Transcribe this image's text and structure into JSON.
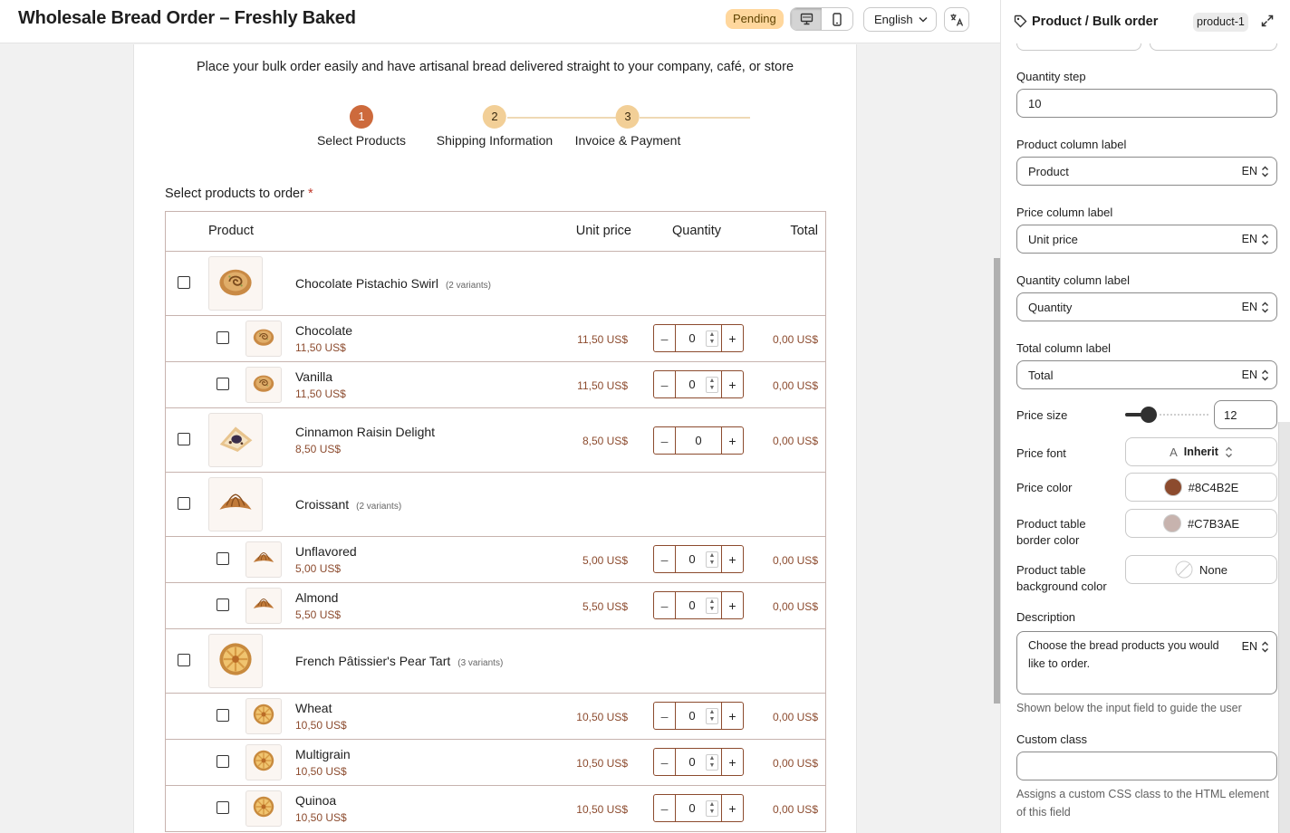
{
  "header": {
    "title": "Wholesale Bread Order – Freshly Baked",
    "status": "Pending",
    "language": "English"
  },
  "form": {
    "subtitle": "Place your bulk order easily and have artisanal bread delivered straight to your company, café, or store",
    "steps": [
      {
        "number": "1",
        "label": "Select Products",
        "state": "active"
      },
      {
        "number": "2",
        "label": "Shipping Information",
        "state": "todo"
      },
      {
        "number": "3",
        "label": "Invoice & Payment",
        "state": "todo"
      }
    ],
    "field_label": "Select products to order",
    "required_mark": "*",
    "table": {
      "columns": {
        "product": "Product",
        "unit_price": "Unit price",
        "quantity": "Quantity",
        "total": "Total"
      },
      "rows": [
        {
          "type": "parent",
          "name": "Chocolate Pistachio Swirl",
          "variants": "(2 variants)",
          "image": "pastry-swirl-icon"
        },
        {
          "type": "child",
          "name": "Chocolate",
          "price": "11,50 US$",
          "unit_price": "11,50 US$",
          "qty": "0",
          "total": "0,00 US$",
          "image": "pastry-swirl-icon"
        },
        {
          "type": "child",
          "name": "Vanilla",
          "price": "11,50 US$",
          "unit_price": "11,50 US$",
          "qty": "0",
          "total": "0,00 US$",
          "image": "pastry-swirl-icon"
        },
        {
          "type": "solo",
          "name": "Cinnamon Raisin Delight",
          "price": "8,50 US$",
          "unit_price": "8,50 US$",
          "qty": "0",
          "total": "0,00 US$",
          "image": "pastry-danish-icon"
        },
        {
          "type": "parent",
          "name": "Croissant",
          "variants": "(2 variants)",
          "image": "croissant-icon"
        },
        {
          "type": "child",
          "name": "Unflavored",
          "price": "5,00 US$",
          "unit_price": "5,00 US$",
          "qty": "0",
          "total": "0,00 US$",
          "image": "croissant-icon"
        },
        {
          "type": "child",
          "name": "Almond",
          "price": "5,50 US$",
          "unit_price": "5,50 US$",
          "qty": "0",
          "total": "0,00 US$",
          "image": "croissant-icon"
        },
        {
          "type": "parent",
          "name": "French Pâtissier's Pear Tart",
          "variants": "(3 variants)",
          "image": "tart-icon"
        },
        {
          "type": "child",
          "name": "Wheat",
          "price": "10,50 US$",
          "unit_price": "10,50 US$",
          "qty": "0",
          "total": "0,00 US$",
          "image": "tart-icon"
        },
        {
          "type": "child",
          "name": "Multigrain",
          "price": "10,50 US$",
          "unit_price": "10,50 US$",
          "qty": "0",
          "total": "0,00 US$",
          "image": "tart-icon"
        },
        {
          "type": "child",
          "name": "Quinoa",
          "price": "10,50 US$",
          "unit_price": "10,50 US$",
          "qty": "0",
          "total": "0,00 US$",
          "image": "tart-icon"
        }
      ]
    }
  },
  "panel": {
    "title": "Product / Bulk order",
    "id": "product-1",
    "fields": {
      "quantity_step_label": "Quantity step",
      "quantity_step_value": "10",
      "product_col_label": "Product column label",
      "product_col_value": "Product",
      "price_col_label": "Price column label",
      "price_col_value": "Unit price",
      "quantity_col_label": "Quantity column label",
      "quantity_col_value": "Quantity",
      "total_col_label": "Total column label",
      "total_col_value": "Total",
      "lang_code": "EN",
      "price_size_label": "Price size",
      "price_size_value": "12",
      "price_size_fraction": 0.25,
      "price_font_label": "Price font",
      "price_font_value": "Inherit",
      "price_color_label": "Price color",
      "price_color_value": "#8C4B2E",
      "border_color_label": "Product table border color",
      "border_color_value": "#C7B3AE",
      "bg_color_label": "Product table background color",
      "bg_color_value": "None",
      "description_label": "Description",
      "description_value": "Choose the bread products you would like to order.",
      "description_help": "Shown below the input field to guide the user",
      "custom_class_label": "Custom class",
      "custom_class_value": "",
      "custom_class_help": "Assigns a custom CSS class to the HTML element of this field"
    }
  },
  "colors": {
    "accent": "#cd6a3c",
    "step_todo": "#f2cf97",
    "price": "#8c4b2e",
    "border": "#c7b3ae",
    "badge": "#ffd79d"
  }
}
